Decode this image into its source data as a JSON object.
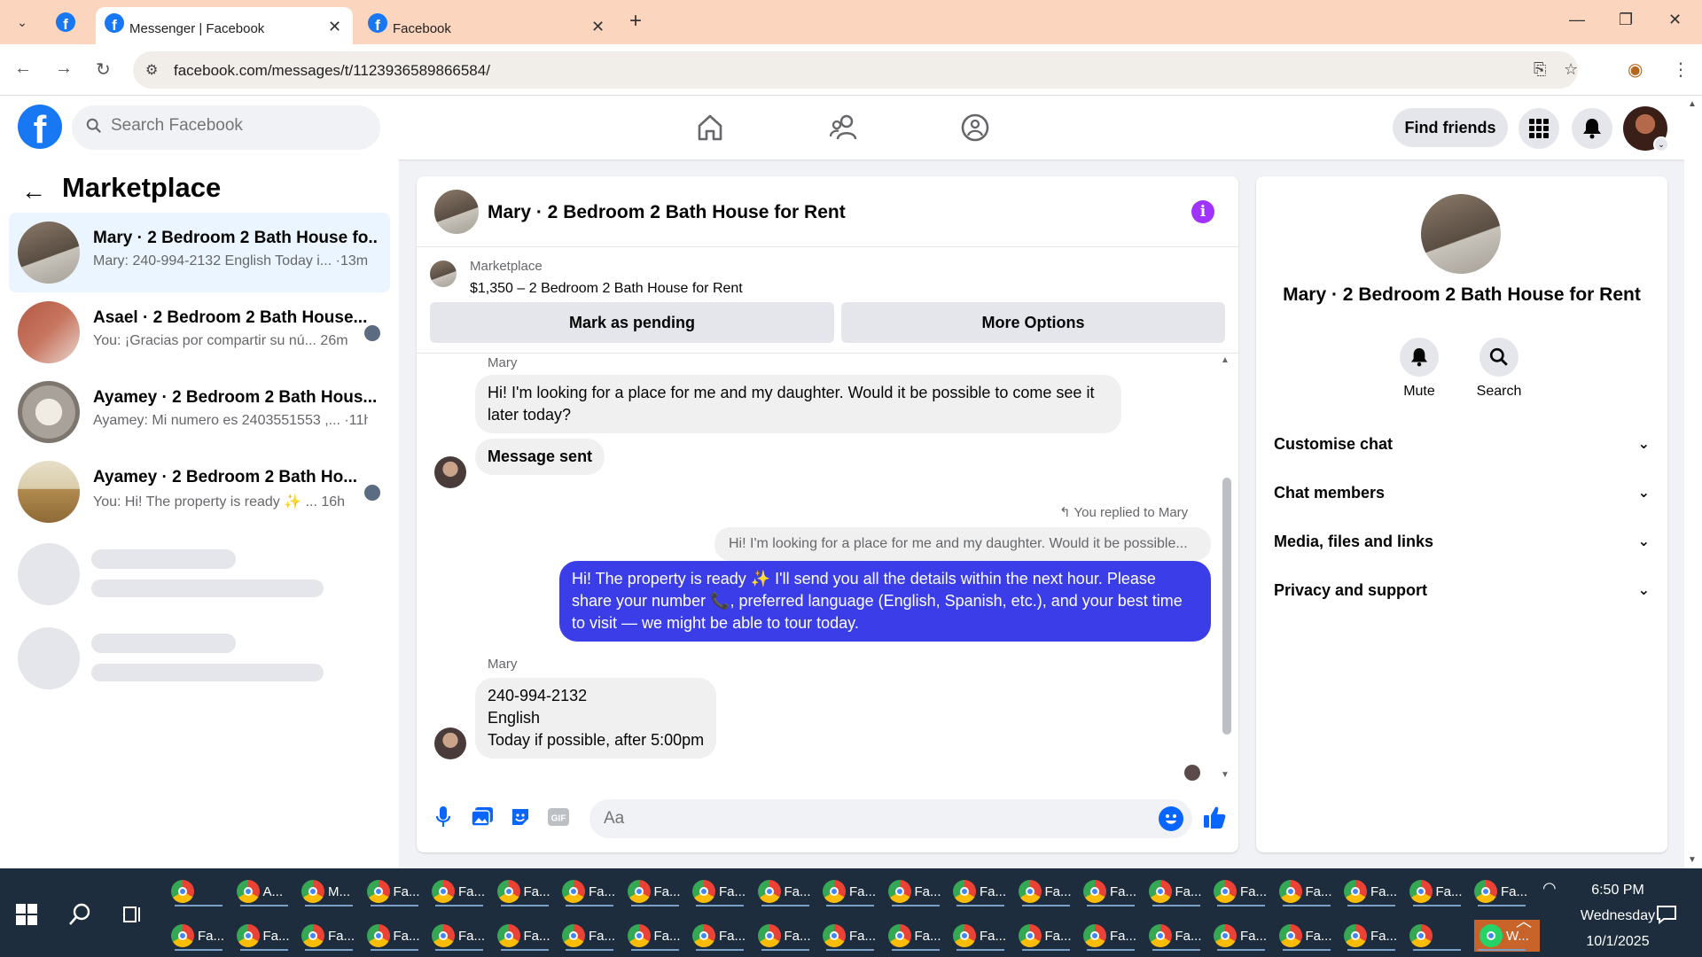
{
  "browser": {
    "tabs": [
      {
        "title": "Messenger | Facebook"
      },
      {
        "title": "Facebook"
      }
    ],
    "url": "facebook.com/messages/t/1123936589866584/"
  },
  "header": {
    "logo": "f",
    "search_placeholder": "Search Facebook",
    "find_friends": "Find friends"
  },
  "sidebar": {
    "title": "Marketplace",
    "conversations": [
      {
        "name": "Mary · 2 Bedroom 2 Bath House fo...",
        "snippet": "Mary: 240-994-2132 English Today i...",
        "time": " ·13m"
      },
      {
        "name": "Asael · 2 Bedroom 2 Bath House...",
        "snippet": "You: ¡Gracias por compartir su nú...",
        "time": "  26m"
      },
      {
        "name": "Ayamey · 2 Bedroom 2 Bath Hous...",
        "snippet": "Ayamey: Mi numero es 2403551553 ,...",
        "time": " ·11h"
      },
      {
        "name": "Ayamey · 2 Bedroom 2 Bath Ho...",
        "snippet": "You: Hi! The property is ready ✨ ...",
        "time": "  16h"
      }
    ]
  },
  "chat": {
    "title": "Mary · 2 Bedroom 2 Bath House for Rent",
    "marketplace_label": "Marketplace",
    "listing": "$1,350 – 2 Bedroom 2 Bath House for Rent",
    "mark_pending": "Mark as pending",
    "more_options": "More Options",
    "messages": {
      "sender1": "Mary",
      "msg1": "Hi! I'm looking for a place for me and my daughter. Would it be possible to come see it later today?",
      "msg2": "Message sent",
      "replied": "You replied to Mary",
      "quoted": "Hi! I'm looking for a place for me and my daughter. Would it be possible...",
      "reply": "Hi! The property is ready ✨ I'll send you all the details within the next hour. Please share your number 📞, preferred language (English, Spanish, etc.), and your best time to visit — we might be able to tour today.",
      "sender2": "Mary",
      "line1": "240-994-2132",
      "line2": "English",
      "line3": "Today if possible, after 5:00pm"
    },
    "composer_placeholder": "Aa"
  },
  "right_panel": {
    "title": "Mary · 2 Bedroom 2 Bath House for Rent",
    "mute": "Mute",
    "search": "Search",
    "sections": [
      "Customise chat",
      "Chat members",
      "Media, files and links",
      "Privacy and support"
    ]
  },
  "taskbar": {
    "row1": [
      "",
      "A...",
      "M...",
      "Fa...",
      "Fa...",
      "Fa...",
      "Fa...",
      "Fa...",
      "Fa...",
      "Fa...",
      "Fa...",
      "Fa...",
      "Fa...",
      "Fa...",
      "Fa...",
      "Fa...",
      "Fa...",
      "Fa...",
      "Fa...",
      "Fa...",
      "Fa..."
    ],
    "row2": [
      "Fa...",
      "Fa...",
      "Fa...",
      "Fa...",
      "Fa...",
      "Fa...",
      "Fa...",
      "Fa...",
      "Fa...",
      "Fa...",
      "Fa...",
      "Fa...",
      "Fa...",
      "Fa...",
      "Fa...",
      "Fa...",
      "Fa...",
      "Fa...",
      "Fa...",
      "",
      "W..."
    ],
    "time": "6:50 PM",
    "day": "Wednesday",
    "date": "10/1/2025"
  },
  "colors": {
    "brand": "#1877f2",
    "sent_bubble": "#3b3ee8",
    "info": "#a033ff",
    "tabbar": "#fbd5be",
    "taskbar": "#1d2d3e"
  }
}
